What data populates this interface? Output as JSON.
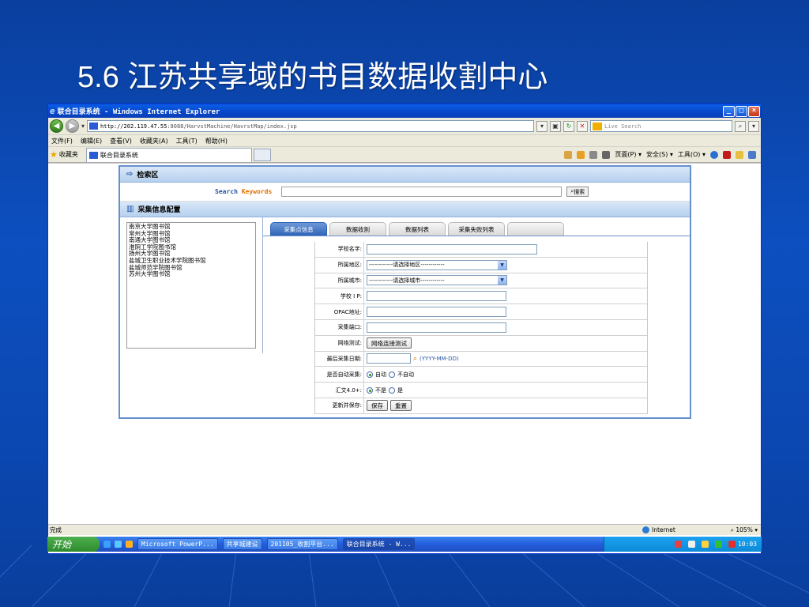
{
  "slide": {
    "title": "5.6 江苏共享域的书目数据收割中心"
  },
  "window": {
    "title": "联合目录系统 - Windows Internet Explorer",
    "minimize": "_",
    "maximize": "□",
    "close": "×"
  },
  "address": {
    "url_host": "http://202.119.47.55",
    "url_path": ":8088/HarvstMachine/HavrstMap/index.jsp",
    "live_search_placeholder": "Live Search"
  },
  "menu": [
    "文件(F)",
    "编辑(E)",
    "查看(V)",
    "收藏夹(A)",
    "工具(T)",
    "帮助(H)"
  ],
  "favorites": {
    "label": "收藏夹",
    "tab_title": "联合目录系统"
  },
  "commands": {
    "page": "页面(P) ▾",
    "safety": "安全(S) ▾",
    "tools": "工具(O) ▾"
  },
  "search_section": {
    "header": "检索区",
    "label_search": "Search",
    "label_keywords": "Keywords",
    "button": "搜索"
  },
  "config_section": {
    "header": "采集信息配置",
    "libraries": [
      "南京大学图书馆",
      "常州大学图书馆",
      "南通大学图书馆",
      "淮阴工学院图书馆",
      "扬州大学图书馆",
      "盐城卫生职业技术学院图书馆",
      "盐城师范学院图书馆",
      "苏州大学图书馆"
    ],
    "tabs": [
      "采集点信息",
      "数据收割",
      "数据列表",
      "采集失败列表",
      ""
    ],
    "form": {
      "school_name": "学校名字:",
      "region": "所属地区:",
      "region_select": "------------请选择地区------------",
      "city": "所属城市:",
      "city_select": "------------请选择城市------------",
      "school_ip": "学校 I P:",
      "opac": "OPAC地址:",
      "port": "采集端口:",
      "net_test": "网络测试:",
      "net_test_btn": "网络连接测试",
      "last_date": "最后采集日期:",
      "date_hint": "(YYYY-MM-DD)",
      "auto": "是否自动采集:",
      "auto_yes": "自动",
      "auto_no": "不自动",
      "huiwen": "汇文4.0+:",
      "huiwen_no": "不是",
      "huiwen_yes": "是",
      "update_save": "更新并保存:",
      "save_btn": "保存",
      "reset_btn": "重置"
    }
  },
  "status": {
    "left": "完成",
    "zone": "Internet",
    "zoom": "105%"
  },
  "taskbar": {
    "start": "开始",
    "items": [
      "Microsoft PowerP...",
      "共享城建设",
      "201105_收割平台...",
      "联合目录系统 - W..."
    ],
    "clock": "10:03"
  }
}
